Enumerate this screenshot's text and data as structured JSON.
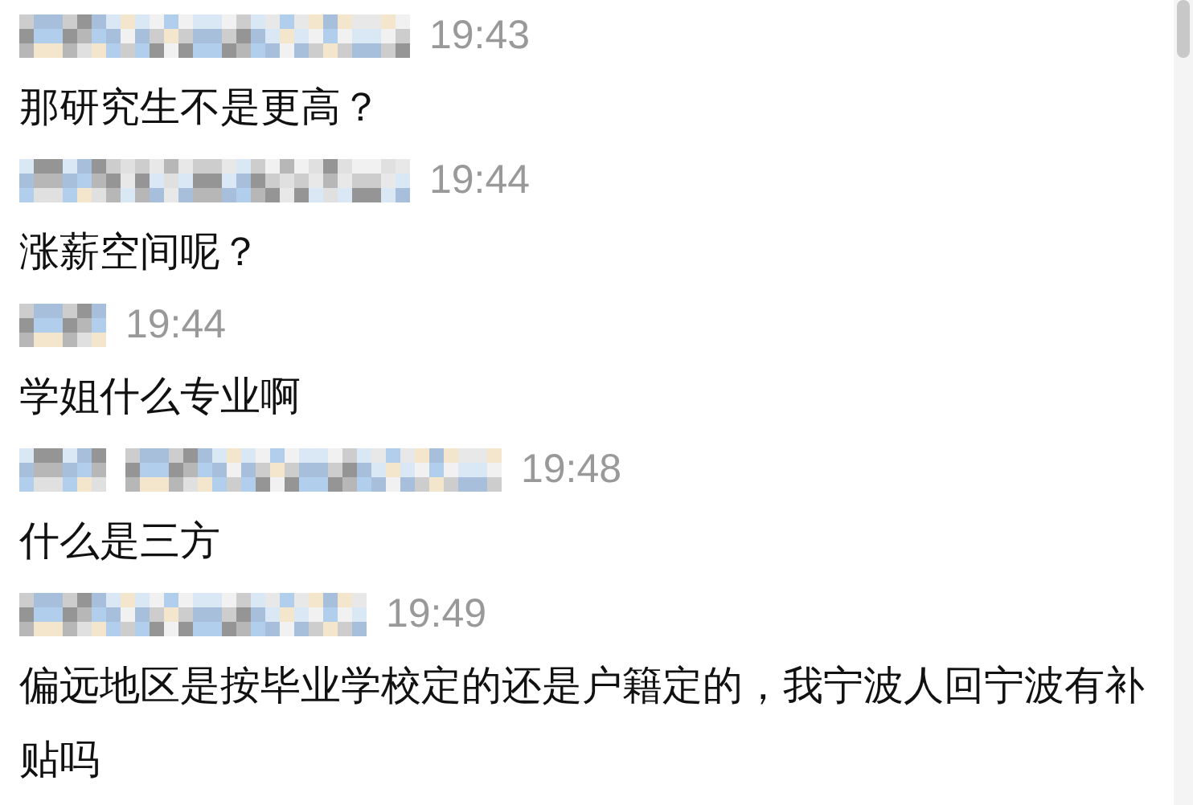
{
  "messages": [
    {
      "time": "19:43",
      "text": "那研究生不是更高？"
    },
    {
      "time": "19:44",
      "text": "涨薪空间呢？"
    },
    {
      "time": "19:44",
      "text": "学姐什么专业啊"
    },
    {
      "time": "19:48",
      "text": "什么是三方"
    },
    {
      "time": "19:49",
      "text": "偏远地区是按毕业学校定的还是户籍定的，我宁波人回宁波有补贴吗"
    }
  ]
}
